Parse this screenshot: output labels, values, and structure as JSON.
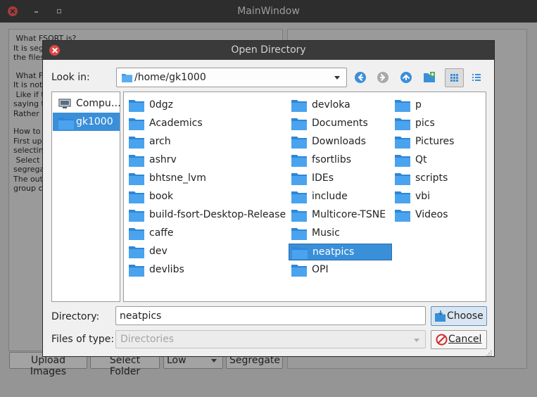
{
  "main_window": {
    "title": "MainWindow",
    "help_text": [
      " What FSORT is?",
      "It is seg",
      "the files",
      "",
      " What F",
      "It is not",
      " Like if t",
      "saying t",
      "Rather",
      "",
      "How to",
      "First up",
      "selectin",
      " Select",
      "segrega",
      "The out",
      "group c"
    ],
    "buttons": {
      "upload": "Upload Images",
      "select_folder": "Select Folder",
      "quality": "Low",
      "segregate": "Segregate"
    }
  },
  "dialog": {
    "title": "Open Directory",
    "look_in_label": "Look in:",
    "look_in_value": "/home/gk1000",
    "sidebar": [
      {
        "label": "Compu…",
        "icon": "computer-icon",
        "selected": false
      },
      {
        "label": "gk1000",
        "icon": "folder-icon",
        "selected": true
      }
    ],
    "folders": [
      [
        "0dgz",
        "Academics",
        "arch",
        "ashrv",
        "bhtsne_lvm",
        "book",
        "build-fsort-Desktop-Release",
        "caffe",
        "dev",
        "devlibs"
      ],
      [
        "devloka",
        "Documents",
        "Downloads",
        "fsortlibs",
        "IDEs",
        "include",
        "Multicore-TSNE",
        "Music",
        "neatpics",
        "OPI"
      ],
      [
        "p",
        "pics",
        "Pictures",
        "Qt",
        "scripts",
        "vbi",
        "Videos"
      ]
    ],
    "selected_folder": "neatpics",
    "directory_label": "Directory:",
    "directory_value": "neatpics",
    "choose_label": "Choose",
    "files_of_type_label": "Files of type:",
    "files_of_type_value": "Directories",
    "cancel_label": "Cancel"
  },
  "colors": {
    "accent": "#3a8fd9",
    "folder": "#3f9be8",
    "dialog_titlebar": "#3a3a3a",
    "close_red": "#dd4747"
  }
}
